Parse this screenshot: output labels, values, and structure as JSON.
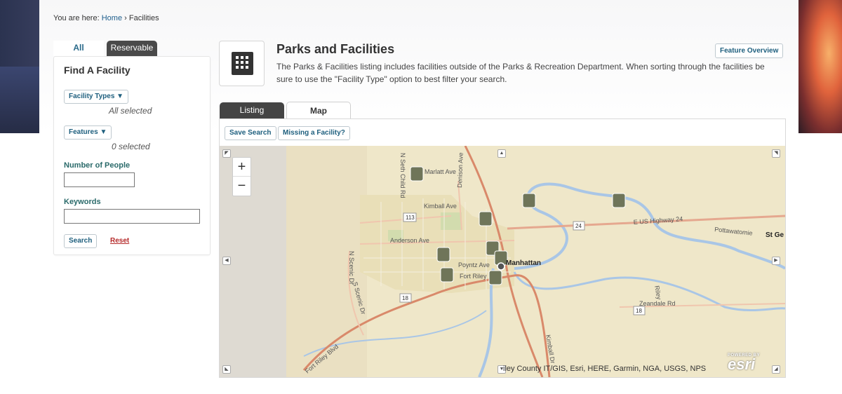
{
  "breadcrumb": {
    "prefix": "You are here:",
    "home": "Home",
    "separator": "›",
    "current": "Facilities"
  },
  "sidebar": {
    "tabs": {
      "all": "All",
      "reservable": "Reservable"
    },
    "title": "Find A Facility",
    "facility_types_label": "Facility Types ▼",
    "facility_types_status": "All selected",
    "features_label": "Features ▼",
    "features_status": "0 selected",
    "people_label": "Number of People",
    "people_value": "",
    "keywords_label": "Keywords",
    "keywords_value": "",
    "search_label": "Search",
    "reset_label": "Reset"
  },
  "main": {
    "title": "Parks and Facilities",
    "description": "The Parks & Facilities listing includes facilities outside of the Parks & Recreation Department. When sorting through the facilities be sure to use the \"Facility Type\" option to best filter your search.",
    "overview_button": "Feature Overview",
    "tabs": {
      "listing": "Listing",
      "map": "Map"
    },
    "save_search": "Save Search",
    "missing_facility": "Missing a Facility?"
  },
  "map": {
    "zoom_in": "+",
    "zoom_out": "−",
    "attribution": "iley County IT/GIS, Esri, HERE, Garmin, NGA, USGS, NPS",
    "esri_powered": "POWERED BY",
    "esri_name": "esri",
    "labels": {
      "marlatt": "Marlatt Ave",
      "seth_child": "N Seth Child Rd",
      "kimball": "Kimball Ave",
      "denison": "Denison Ave",
      "hwy24": "E US Highway 24",
      "pottawatomie": "Pottawatomie",
      "st_george": "St Ge",
      "anderson": "Anderson Ave",
      "scenic": "N Scenic Dr",
      "poyntz": "Poyntz Ave",
      "manhattan": "Manhattan",
      "fort_riley": "Fort Riley",
      "s_scenic": "S Scenic Dr",
      "zeandale": "Zeandale Rd",
      "riley": "Riley",
      "ft_riley_blvd": "Fort Riley Blvd",
      "kimball_dr": "Kimball Dr",
      "r113": "113",
      "r24": "24",
      "r18a": "18",
      "r18b": "18"
    },
    "colors": {
      "land": "#efe7c9",
      "water": "#a9c6e6",
      "urban": "#e9dfb8",
      "road_major": "#d9896a",
      "road_minor": "#f3f0e6",
      "marker": "#6f7559"
    }
  }
}
